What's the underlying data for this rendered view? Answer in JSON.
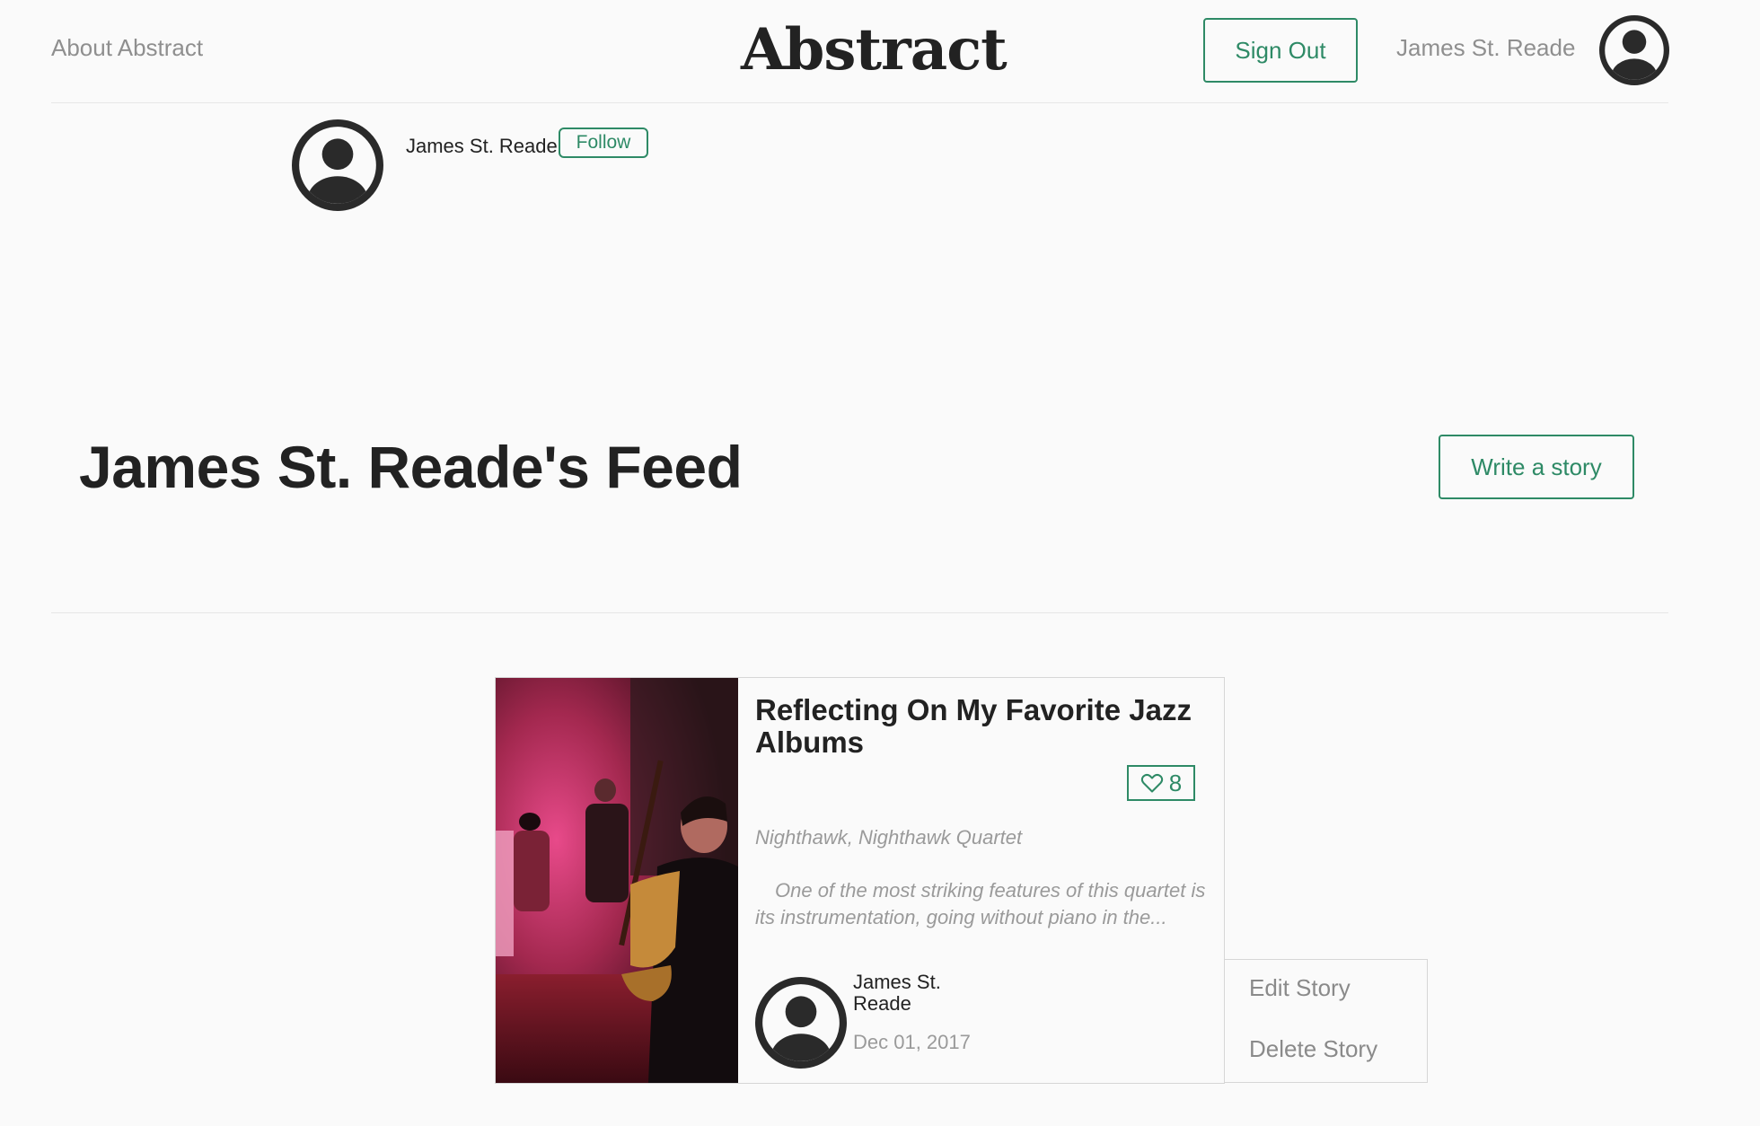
{
  "header": {
    "about_label": "About Abstract",
    "brand": "Abstract",
    "sign_out_label": "Sign Out",
    "username": "James St. Reade"
  },
  "profile": {
    "name": "James St. Reade",
    "follow_label": "Follow"
  },
  "feed": {
    "title": "James St. Reade's Feed",
    "write_story_label": "Write a story"
  },
  "story": {
    "title": "Reflecting On My Favorite Jazz Albums",
    "likes": "8",
    "subtitle": "Nighthawk, Nighthawk Quartet",
    "excerpt": "One of the most striking features of this quartet is its instrumentation, going without piano in the...",
    "author": "James St. Reade",
    "date": "Dec 01, 2017"
  },
  "story_menu": {
    "edit_label": "Edit Story",
    "delete_label": "Delete Story"
  },
  "colors": {
    "accent": "#2e8a66",
    "muted_text": "#8f8f8f",
    "text": "#222222",
    "background": "#fafafa"
  },
  "icons": {
    "avatar": "user-avatar-icon",
    "like": "heart-icon"
  }
}
